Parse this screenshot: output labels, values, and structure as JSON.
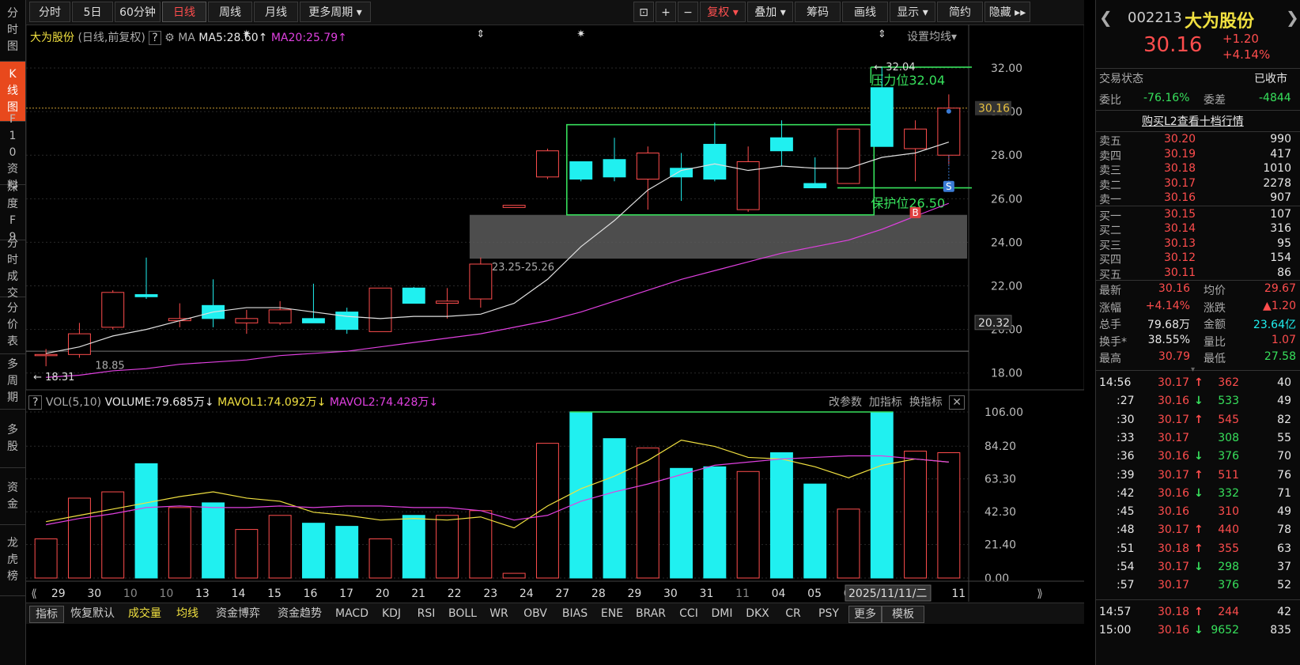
{
  "left_tabs": [
    {
      "label": "分时图",
      "active": false
    },
    {
      "label": "K线图",
      "active": true
    },
    {
      "label": "F10资料",
      "active": false
    },
    {
      "label": "深度F9",
      "active": false
    },
    {
      "label": "分时成交",
      "active": false
    },
    {
      "label": "分价表",
      "active": false
    },
    {
      "label": "多周期",
      "active": false
    },
    {
      "label": "多股",
      "active": false
    },
    {
      "label": "资金",
      "active": false
    },
    {
      "label": "龙虎榜",
      "active": false
    }
  ],
  "toolbar": {
    "periods": [
      "分时",
      "5日",
      "60分钟",
      "日线",
      "周线",
      "月线",
      "更多周期"
    ],
    "active_period": "日线",
    "tools": [
      "复权",
      "叠加",
      "筹码",
      "画线",
      "显示",
      "简约",
      "隐藏"
    ]
  },
  "chart_header": {
    "stock_name": "大为股份",
    "mode": "(日线,前复权)",
    "ma_label": "MA",
    "ma5": "MA5:28.60",
    "ma20": "MA20:25.79",
    "settings": "设置均线"
  },
  "annotations": {
    "resistance_price": "32.04",
    "resistance_label": "压力位32.04",
    "support_label": "保护位26.50",
    "zone_label": "23.25-25.26",
    "low_label": "18.31",
    "start_label": "18.85",
    "current_price_tag": "30.16",
    "crosshair_price_tag": "20.32",
    "sell_marker": "S",
    "buy_marker": "B"
  },
  "volume_header": {
    "title": "VOL(5,10)",
    "volume": "VOLUME:79.685万",
    "mavol1": "MAVOL1:74.092万",
    "mavol2": "MAVOL2:74.428万",
    "actions": [
      "改参数",
      "加指标",
      "换指标"
    ]
  },
  "x_axis_labels": [
    "29",
    "30",
    "10",
    "10",
    "13",
    "14",
    "15",
    "16",
    "17",
    "20",
    "21",
    "22",
    "23",
    "24",
    "27",
    "28",
    "29",
    "30",
    "31",
    "11",
    "04",
    "05",
    "06",
    "07",
    "10",
    "11"
  ],
  "date_tag": "2025/11/11/二",
  "bottom_tabs": [
    "指标",
    "恢复默认",
    "成交量",
    "均线",
    "资金博弈",
    "资金趋势",
    "MACD",
    "KDJ",
    "RSI",
    "BOLL",
    "WR",
    "OBV",
    "BIAS",
    "ENE",
    "BRAR",
    "CCI",
    "DMI",
    "DKX",
    "CR",
    "PSY",
    "更多",
    "模板"
  ],
  "chart_data": {
    "type": "candlestick",
    "price_axis": {
      "ticks": [
        32.0,
        30.0,
        28.0,
        26.0,
        24.0,
        22.0,
        20.0,
        18.0
      ],
      "ylim": [
        17.3,
        33.2
      ]
    },
    "volume_axis": {
      "ticks": [
        106.0,
        84.2,
        63.3,
        42.3,
        21.4,
        0.0
      ],
      "ylim": [
        0,
        106
      ]
    },
    "candles": [
      {
        "o": 18.85,
        "h": 19.1,
        "l": 18.31,
        "c": 18.85,
        "v": 25
      },
      {
        "o": 18.85,
        "h": 20.3,
        "l": 18.7,
        "c": 19.8,
        "v": 51
      },
      {
        "o": 20.1,
        "h": 21.8,
        "l": 20.0,
        "c": 21.7,
        "v": 55
      },
      {
        "o": 21.6,
        "h": 23.3,
        "l": 21.4,
        "c": 21.5,
        "v": 73
      },
      {
        "o": 20.4,
        "h": 21.2,
        "l": 20.1,
        "c": 20.5,
        "v": 45
      },
      {
        "o": 21.1,
        "h": 22.3,
        "l": 20.1,
        "c": 20.5,
        "v": 48
      },
      {
        "o": 20.3,
        "h": 20.9,
        "l": 19.8,
        "c": 20.5,
        "v": 31
      },
      {
        "o": 20.3,
        "h": 21.3,
        "l": 20.2,
        "c": 20.9,
        "v": 40
      },
      {
        "o": 20.5,
        "h": 22.1,
        "l": 20.4,
        "c": 20.3,
        "v": 35
      },
      {
        "o": 20.8,
        "h": 21.0,
        "l": 19.8,
        "c": 20.0,
        "v": 33
      },
      {
        "o": 19.9,
        "h": 21.9,
        "l": 19.9,
        "c": 21.9,
        "v": 25
      },
      {
        "o": 21.9,
        "h": 21.95,
        "l": 21.2,
        "c": 21.2,
        "v": 40
      },
      {
        "o": 21.2,
        "h": 21.9,
        "l": 20.5,
        "c": 21.3,
        "v": 40
      },
      {
        "o": 21.4,
        "h": 23.3,
        "l": 21.0,
        "c": 23.0,
        "v": 43
      },
      {
        "o": 25.6,
        "h": 25.7,
        "l": 25.6,
        "c": 25.7,
        "v": 3
      },
      {
        "o": 27.0,
        "h": 28.3,
        "l": 26.9,
        "c": 28.2,
        "v": 86
      },
      {
        "o": 27.7,
        "h": 27.7,
        "l": 26.8,
        "c": 26.9,
        "v": 106
      },
      {
        "o": 27.8,
        "h": 28.8,
        "l": 26.8,
        "c": 27.0,
        "v": 89
      },
      {
        "o": 26.9,
        "h": 28.4,
        "l": 25.5,
        "c": 28.1,
        "v": 83
      },
      {
        "o": 27.4,
        "h": 28.1,
        "l": 25.9,
        "c": 27.0,
        "v": 70
      },
      {
        "o": 28.5,
        "h": 29.5,
        "l": 26.8,
        "c": 26.9,
        "v": 71
      },
      {
        "o": 25.5,
        "h": 28.4,
        "l": 25.4,
        "c": 27.7,
        "v": 68
      },
      {
        "o": 28.8,
        "h": 29.6,
        "l": 27.5,
        "c": 28.2,
        "v": 80
      },
      {
        "o": 26.7,
        "h": 27.9,
        "l": 26.5,
        "c": 26.5,
        "v": 60
      },
      {
        "o": 26.7,
        "h": 29.2,
        "l": 26.7,
        "c": 29.2,
        "v": 44
      },
      {
        "o": 31.1,
        "h": 32.04,
        "l": 28.4,
        "c": 28.4,
        "v": 106
      },
      {
        "o": 28.3,
        "h": 29.6,
        "l": 26.8,
        "c": 29.2,
        "v": 81
      },
      {
        "o": 28.0,
        "h": 30.79,
        "l": 27.58,
        "c": 30.16,
        "v": 80
      }
    ],
    "ma5": [
      18.9,
      19.2,
      19.7,
      20.0,
      20.4,
      20.8,
      21.0,
      21.0,
      20.8,
      20.6,
      20.5,
      20.6,
      20.6,
      20.7,
      21.2,
      22.3,
      23.8,
      25.0,
      26.4,
      27.3,
      27.6,
      27.3,
      27.5,
      27.4,
      27.4,
      27.9,
      28.1,
      28.6
    ],
    "ma20": [
      17.8,
      17.9,
      18.1,
      18.2,
      18.4,
      18.5,
      18.6,
      18.8,
      18.9,
      19.0,
      19.2,
      19.4,
      19.6,
      19.8,
      20.1,
      20.4,
      20.8,
      21.3,
      21.8,
      22.3,
      22.7,
      23.1,
      23.5,
      23.8,
      24.1,
      24.6,
      25.2,
      25.79
    ],
    "mavol1": [
      36,
      40,
      44,
      48,
      52,
      55,
      51,
      49,
      42,
      40,
      37,
      38,
      37,
      39,
      32,
      46,
      57,
      65,
      75,
      88,
      84,
      77,
      76,
      71,
      64,
      72,
      76,
      74
    ],
    "mavol2": [
      34,
      38,
      41,
      45,
      46,
      45,
      45,
      46,
      45,
      46,
      46,
      45,
      45,
      43,
      37,
      40,
      49,
      55,
      60,
      66,
      72,
      74,
      76,
      77,
      78,
      78,
      76,
      74
    ],
    "resistance": 32.04,
    "support": 26.5,
    "zone": [
      23.25,
      25.26
    ],
    "box": [
      25.26,
      29.4
    ]
  },
  "quote_panel": {
    "code": "002213",
    "name": "大为股份",
    "price": "30.16",
    "change": "+1.20",
    "change_pct": "+4.14%",
    "status_label": "交易状态",
    "status_value": "已收市",
    "weibi_label": "委比",
    "weibi_value": "-76.16%",
    "weicha_label": "委差",
    "weicha_value": "-4844",
    "l2_link": "购买L2查看十档行情",
    "asks": [
      {
        "label": "卖五",
        "price": "30.20",
        "vol": "990"
      },
      {
        "label": "卖四",
        "price": "30.19",
        "vol": "417"
      },
      {
        "label": "卖三",
        "price": "30.18",
        "vol": "1010"
      },
      {
        "label": "卖二",
        "price": "30.17",
        "vol": "2278"
      },
      {
        "label": "卖一",
        "price": "30.16",
        "vol": "907"
      }
    ],
    "bids": [
      {
        "label": "买一",
        "price": "30.15",
        "vol": "107"
      },
      {
        "label": "买二",
        "price": "30.14",
        "vol": "316"
      },
      {
        "label": "买三",
        "price": "30.13",
        "vol": "95"
      },
      {
        "label": "买四",
        "price": "30.12",
        "vol": "154"
      },
      {
        "label": "买五",
        "price": "30.11",
        "vol": "86"
      }
    ],
    "stats": [
      {
        "l1": "最新",
        "v1": "30.16",
        "l2": "均价",
        "v2": "29.67",
        "c1": "red",
        "c2": "red"
      },
      {
        "l1": "涨幅",
        "v1": "+4.14%",
        "l2": "涨跌",
        "v2": "▲1.20",
        "c1": "red",
        "c2": "red"
      },
      {
        "l1": "总手",
        "v1": "79.68万",
        "l2": "金额",
        "v2": "23.64亿",
        "c1": "white",
        "c2": "cyan"
      },
      {
        "l1": "换手*",
        "v1": "38.55%",
        "l2": "量比",
        "v2": "1.07",
        "c1": "white",
        "c2": "red"
      },
      {
        "l1": "最高",
        "v1": "30.79",
        "l2": "最低",
        "v2": "27.58",
        "c1": "red",
        "c2": "green"
      }
    ],
    "ticks": [
      {
        "t": "14:56",
        "p": "30.17",
        "arrow": "↑",
        "v": "362",
        "n": "40",
        "pc": "red",
        "vc": "red"
      },
      {
        "t": ":27",
        "p": "30.16",
        "arrow": "↓",
        "v": "533",
        "n": "49",
        "pc": "red",
        "vc": "green"
      },
      {
        "t": ":30",
        "p": "30.17",
        "arrow": "↑",
        "v": "545",
        "n": "82",
        "pc": "red",
        "vc": "red"
      },
      {
        "t": ":33",
        "p": "30.17",
        "arrow": "",
        "v": "308",
        "n": "55",
        "pc": "red",
        "vc": "green"
      },
      {
        "t": ":36",
        "p": "30.16",
        "arrow": "↓",
        "v": "376",
        "n": "70",
        "pc": "red",
        "vc": "green"
      },
      {
        "t": ":39",
        "p": "30.17",
        "arrow": "↑",
        "v": "511",
        "n": "76",
        "pc": "red",
        "vc": "red"
      },
      {
        "t": ":42",
        "p": "30.16",
        "arrow": "↓",
        "v": "332",
        "n": "71",
        "pc": "red",
        "vc": "green"
      },
      {
        "t": ":45",
        "p": "30.16",
        "arrow": "",
        "v": "310",
        "n": "49",
        "pc": "red",
        "vc": "red"
      },
      {
        "t": ":48",
        "p": "30.17",
        "arrow": "↑",
        "v": "440",
        "n": "78",
        "pc": "red",
        "vc": "red"
      },
      {
        "t": ":51",
        "p": "30.18",
        "arrow": "↑",
        "v": "355",
        "n": "63",
        "pc": "red",
        "vc": "red"
      },
      {
        "t": ":54",
        "p": "30.17",
        "arrow": "↓",
        "v": "298",
        "n": "37",
        "pc": "red",
        "vc": "green"
      },
      {
        "t": ":57",
        "p": "30.17",
        "arrow": "",
        "v": "376",
        "n": "52",
        "pc": "red",
        "vc": "green"
      },
      {
        "t": "14:57",
        "p": "30.18",
        "arrow": "↑",
        "v": "244",
        "n": "42",
        "pc": "red",
        "vc": "red"
      },
      {
        "t": "15:00",
        "p": "30.16",
        "arrow": "↓",
        "v": "9652",
        "n": "835",
        "pc": "red",
        "vc": "green"
      }
    ]
  },
  "colors": {
    "up": "#ff4d4d",
    "down": "#20f0f0",
    "ma5": "#e0e0e0",
    "ma20": "#e040e0",
    "mavol1": "#f0e040",
    "mavol2": "#e040e0",
    "box": "#37e05c",
    "accent": "#e8491d"
  }
}
